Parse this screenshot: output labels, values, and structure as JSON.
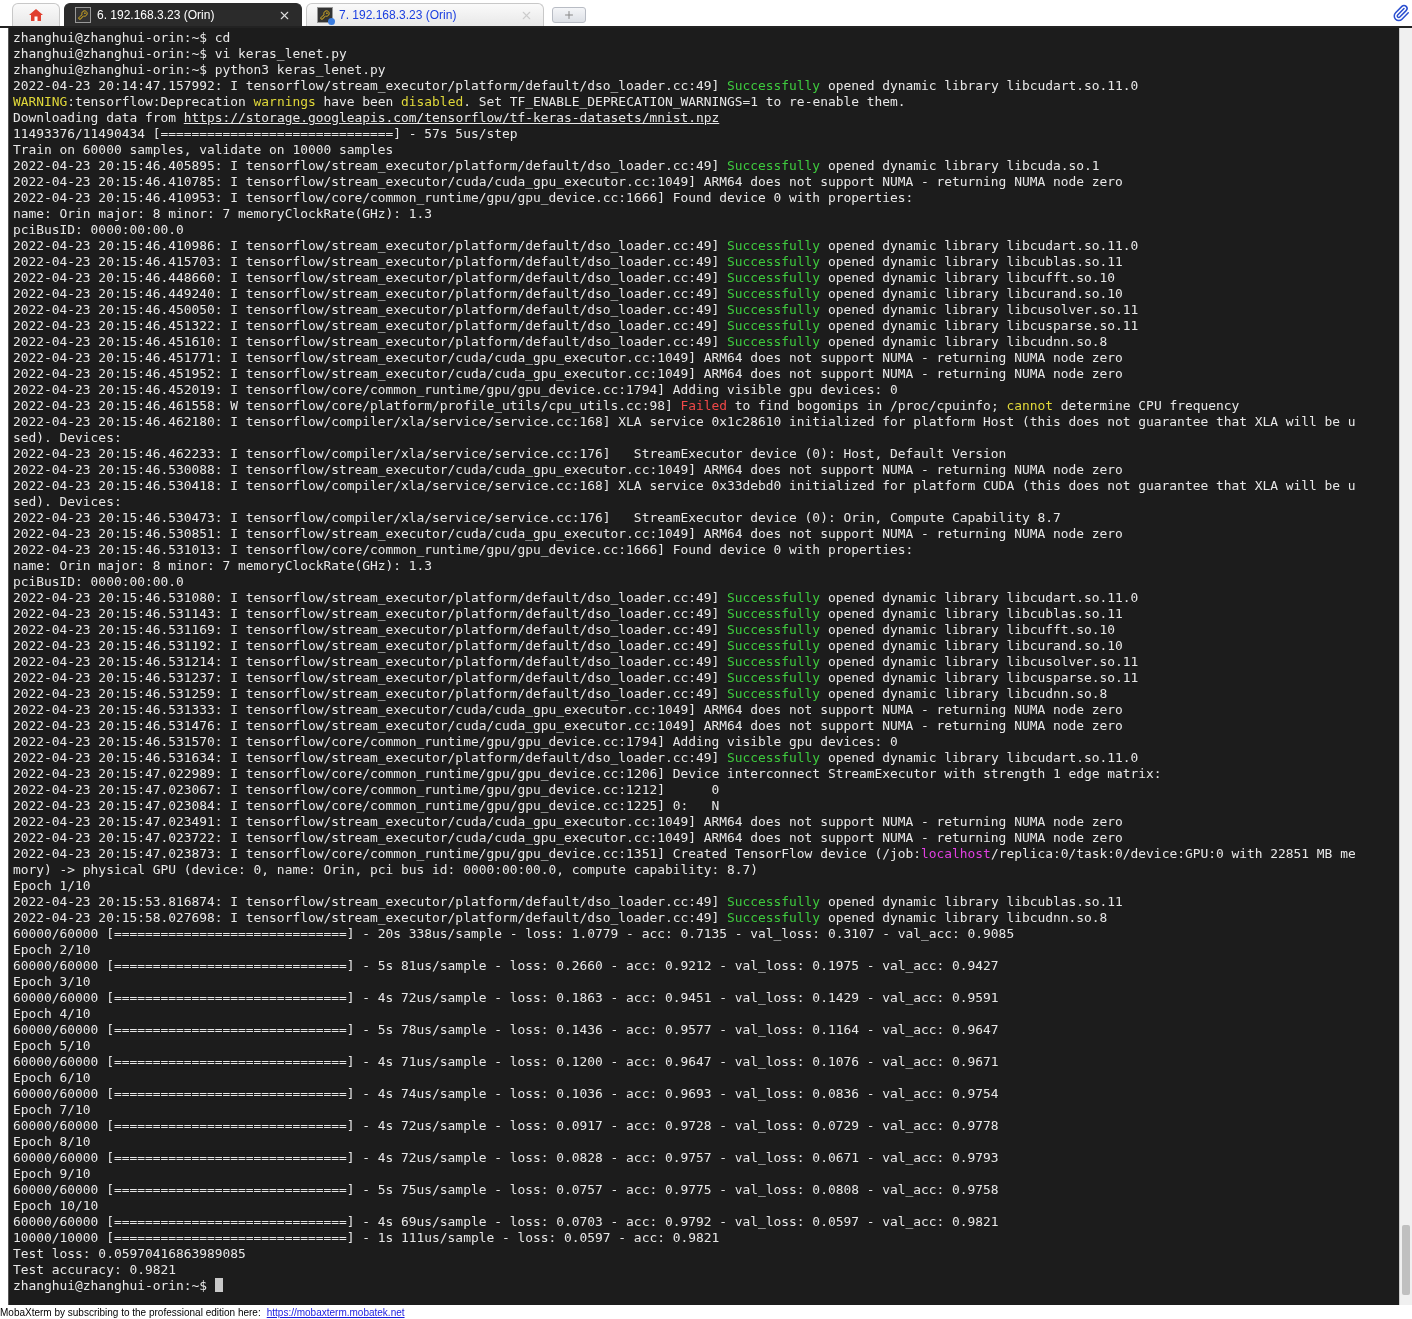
{
  "tabs": [
    {
      "kind": "home",
      "selected": false
    },
    {
      "kind": "session",
      "label": "6. 192.168.3.23 (Orin)",
      "selected": true
    },
    {
      "kind": "session",
      "label": "7. 192.168.3.23 (Orin)",
      "selected": false
    }
  ],
  "terminal": {
    "lines": [
      {
        "text": "zhanghui@zhanghui-orin:~$ cd"
      },
      {
        "text": "zhanghui@zhanghui-orin:~$ vi keras_lenet.py"
      },
      {
        "text": "zhanghui@zhanghui-orin:~$ python3 keras_lenet.py"
      },
      {
        "parts": [
          {
            "kind": "plain",
            "text": "2022-04-23 20:14:47.157992: I tensorflow/stream_executor/platform/default/dso_loader.cc:49] "
          },
          {
            "kind": "success",
            "text": "Successfully"
          },
          {
            "kind": "plain",
            "text": " opened dynamic library libcudart.so.11.0"
          }
        ]
      },
      {
        "parts": [
          {
            "kind": "warn",
            "text": "WARNING"
          },
          {
            "kind": "plain",
            "text": ":tensorflow:Deprecation "
          },
          {
            "kind": "warn",
            "text": "warnings"
          },
          {
            "kind": "plain",
            "text": " have been "
          },
          {
            "kind": "warn",
            "text": "disabled"
          },
          {
            "kind": "plain",
            "text": ". Set TF_ENABLE_DEPRECATION_WARNINGS=1 to re-enable them."
          }
        ]
      },
      {
        "parts": [
          {
            "kind": "plain",
            "text": "Downloading data from "
          },
          {
            "kind": "link",
            "text": "https://storage.googleapis.com/tensorflow/tf-keras-datasets/mnist.npz"
          }
        ]
      },
      {
        "text": "11493376/11490434 [==============================] - 57s 5us/step"
      },
      {
        "text": "Train on 60000 samples, validate on 10000 samples"
      },
      {
        "parts": [
          {
            "kind": "plain",
            "text": "2022-04-23 20:15:46.405895: I tensorflow/stream_executor/platform/default/dso_loader.cc:49] "
          },
          {
            "kind": "success",
            "text": "Successfully"
          },
          {
            "kind": "plain",
            "text": " opened dynamic library libcuda.so.1"
          }
        ]
      },
      {
        "text": "2022-04-23 20:15:46.410785: I tensorflow/stream_executor/cuda/cuda_gpu_executor.cc:1049] ARM64 does not support NUMA - returning NUMA node zero"
      },
      {
        "text": "2022-04-23 20:15:46.410953: I tensorflow/core/common_runtime/gpu/gpu_device.cc:1666] Found device 0 with properties:"
      },
      {
        "text": "name: Orin major: 8 minor: 7 memoryClockRate(GHz): 1.3"
      },
      {
        "text": "pciBusID: 0000:00:00.0"
      },
      {
        "parts": [
          {
            "kind": "plain",
            "text": "2022-04-23 20:15:46.410986: I tensorflow/stream_executor/platform/default/dso_loader.cc:49] "
          },
          {
            "kind": "success",
            "text": "Successfully"
          },
          {
            "kind": "plain",
            "text": " opened dynamic library libcudart.so.11.0"
          }
        ]
      },
      {
        "parts": [
          {
            "kind": "plain",
            "text": "2022-04-23 20:15:46.415703: I tensorflow/stream_executor/platform/default/dso_loader.cc:49] "
          },
          {
            "kind": "success",
            "text": "Successfully"
          },
          {
            "kind": "plain",
            "text": " opened dynamic library libcublas.so.11"
          }
        ]
      },
      {
        "parts": [
          {
            "kind": "plain",
            "text": "2022-04-23 20:15:46.448660: I tensorflow/stream_executor/platform/default/dso_loader.cc:49] "
          },
          {
            "kind": "success",
            "text": "Successfully"
          },
          {
            "kind": "plain",
            "text": " opened dynamic library libcufft.so.10"
          }
        ]
      },
      {
        "parts": [
          {
            "kind": "plain",
            "text": "2022-04-23 20:15:46.449240: I tensorflow/stream_executor/platform/default/dso_loader.cc:49] "
          },
          {
            "kind": "success",
            "text": "Successfully"
          },
          {
            "kind": "plain",
            "text": " opened dynamic library libcurand.so.10"
          }
        ]
      },
      {
        "parts": [
          {
            "kind": "plain",
            "text": "2022-04-23 20:15:46.450050: I tensorflow/stream_executor/platform/default/dso_loader.cc:49] "
          },
          {
            "kind": "success",
            "text": "Successfully"
          },
          {
            "kind": "plain",
            "text": " opened dynamic library libcusolver.so.11"
          }
        ]
      },
      {
        "parts": [
          {
            "kind": "plain",
            "text": "2022-04-23 20:15:46.451322: I tensorflow/stream_executor/platform/default/dso_loader.cc:49] "
          },
          {
            "kind": "success",
            "text": "Successfully"
          },
          {
            "kind": "plain",
            "text": " opened dynamic library libcusparse.so.11"
          }
        ]
      },
      {
        "parts": [
          {
            "kind": "plain",
            "text": "2022-04-23 20:15:46.451610: I tensorflow/stream_executor/platform/default/dso_loader.cc:49] "
          },
          {
            "kind": "success",
            "text": "Successfully"
          },
          {
            "kind": "plain",
            "text": " opened dynamic library libcudnn.so.8"
          }
        ]
      },
      {
        "text": "2022-04-23 20:15:46.451771: I tensorflow/stream_executor/cuda/cuda_gpu_executor.cc:1049] ARM64 does not support NUMA - returning NUMA node zero"
      },
      {
        "text": "2022-04-23 20:15:46.451952: I tensorflow/stream_executor/cuda/cuda_gpu_executor.cc:1049] ARM64 does not support NUMA - returning NUMA node zero"
      },
      {
        "text": "2022-04-23 20:15:46.452019: I tensorflow/core/common_runtime/gpu/gpu_device.cc:1794] Adding visible gpu devices: 0"
      },
      {
        "parts": [
          {
            "kind": "plain",
            "text": "2022-04-23 20:15:46.461558: W tensorflow/core/platform/profile_utils/cpu_utils.cc:98] "
          },
          {
            "kind": "error",
            "text": "Failed"
          },
          {
            "kind": "plain",
            "text": " to find bogomips in /proc/cpuinfo; "
          },
          {
            "kind": "warn",
            "text": "cannot"
          },
          {
            "kind": "plain",
            "text": " determine CPU frequency"
          }
        ]
      },
      {
        "text": "2022-04-23 20:15:46.462180: I tensorflow/compiler/xla/service/service.cc:168] XLA service 0x1c28610 initialized for platform Host (this does not guarantee that XLA will be u"
      },
      {
        "text": "sed). Devices:"
      },
      {
        "text": "2022-04-23 20:15:46.462233: I tensorflow/compiler/xla/service/service.cc:176]   StreamExecutor device (0): Host, Default Version"
      },
      {
        "text": "2022-04-23 20:15:46.530088: I tensorflow/stream_executor/cuda/cuda_gpu_executor.cc:1049] ARM64 does not support NUMA - returning NUMA node zero"
      },
      {
        "text": "2022-04-23 20:15:46.530418: I tensorflow/compiler/xla/service/service.cc:168] XLA service 0x33debd0 initialized for platform CUDA (this does not guarantee that XLA will be u"
      },
      {
        "text": "sed). Devices:"
      },
      {
        "text": "2022-04-23 20:15:46.530473: I tensorflow/compiler/xla/service/service.cc:176]   StreamExecutor device (0): Orin, Compute Capability 8.7"
      },
      {
        "text": "2022-04-23 20:15:46.530851: I tensorflow/stream_executor/cuda/cuda_gpu_executor.cc:1049] ARM64 does not support NUMA - returning NUMA node zero"
      },
      {
        "text": "2022-04-23 20:15:46.531013: I tensorflow/core/common_runtime/gpu/gpu_device.cc:1666] Found device 0 with properties:"
      },
      {
        "text": "name: Orin major: 8 minor: 7 memoryClockRate(GHz): 1.3"
      },
      {
        "text": "pciBusID: 0000:00:00.0"
      },
      {
        "parts": [
          {
            "kind": "plain",
            "text": "2022-04-23 20:15:46.531080: I tensorflow/stream_executor/platform/default/dso_loader.cc:49] "
          },
          {
            "kind": "success",
            "text": "Successfully"
          },
          {
            "kind": "plain",
            "text": " opened dynamic library libcudart.so.11.0"
          }
        ]
      },
      {
        "parts": [
          {
            "kind": "plain",
            "text": "2022-04-23 20:15:46.531143: I tensorflow/stream_executor/platform/default/dso_loader.cc:49] "
          },
          {
            "kind": "success",
            "text": "Successfully"
          },
          {
            "kind": "plain",
            "text": " opened dynamic library libcublas.so.11"
          }
        ]
      },
      {
        "parts": [
          {
            "kind": "plain",
            "text": "2022-04-23 20:15:46.531169: I tensorflow/stream_executor/platform/default/dso_loader.cc:49] "
          },
          {
            "kind": "success",
            "text": "Successfully"
          },
          {
            "kind": "plain",
            "text": " opened dynamic library libcufft.so.10"
          }
        ]
      },
      {
        "parts": [
          {
            "kind": "plain",
            "text": "2022-04-23 20:15:46.531192: I tensorflow/stream_executor/platform/default/dso_loader.cc:49] "
          },
          {
            "kind": "success",
            "text": "Successfully"
          },
          {
            "kind": "plain",
            "text": " opened dynamic library libcurand.so.10"
          }
        ]
      },
      {
        "parts": [
          {
            "kind": "plain",
            "text": "2022-04-23 20:15:46.531214: I tensorflow/stream_executor/platform/default/dso_loader.cc:49] "
          },
          {
            "kind": "success",
            "text": "Successfully"
          },
          {
            "kind": "plain",
            "text": " opened dynamic library libcusolver.so.11"
          }
        ]
      },
      {
        "parts": [
          {
            "kind": "plain",
            "text": "2022-04-23 20:15:46.531237: I tensorflow/stream_executor/platform/default/dso_loader.cc:49] "
          },
          {
            "kind": "success",
            "text": "Successfully"
          },
          {
            "kind": "plain",
            "text": " opened dynamic library libcusparse.so.11"
          }
        ]
      },
      {
        "parts": [
          {
            "kind": "plain",
            "text": "2022-04-23 20:15:46.531259: I tensorflow/stream_executor/platform/default/dso_loader.cc:49] "
          },
          {
            "kind": "success",
            "text": "Successfully"
          },
          {
            "kind": "plain",
            "text": " opened dynamic library libcudnn.so.8"
          }
        ]
      },
      {
        "text": "2022-04-23 20:15:46.531333: I tensorflow/stream_executor/cuda/cuda_gpu_executor.cc:1049] ARM64 does not support NUMA - returning NUMA node zero"
      },
      {
        "text": "2022-04-23 20:15:46.531476: I tensorflow/stream_executor/cuda/cuda_gpu_executor.cc:1049] ARM64 does not support NUMA - returning NUMA node zero"
      },
      {
        "text": "2022-04-23 20:15:46.531570: I tensorflow/core/common_runtime/gpu/gpu_device.cc:1794] Adding visible gpu devices: 0"
      },
      {
        "parts": [
          {
            "kind": "plain",
            "text": "2022-04-23 20:15:46.531634: I tensorflow/stream_executor/platform/default/dso_loader.cc:49] "
          },
          {
            "kind": "success",
            "text": "Successfully"
          },
          {
            "kind": "plain",
            "text": " opened dynamic library libcudart.so.11.0"
          }
        ]
      },
      {
        "text": "2022-04-23 20:15:47.022989: I tensorflow/core/common_runtime/gpu/gpu_device.cc:1206] Device interconnect StreamExecutor with strength 1 edge matrix:"
      },
      {
        "text": "2022-04-23 20:15:47.023067: I tensorflow/core/common_runtime/gpu/gpu_device.cc:1212]      0"
      },
      {
        "text": "2022-04-23 20:15:47.023084: I tensorflow/core/common_runtime/gpu/gpu_device.cc:1225] 0:   N"
      },
      {
        "text": "2022-04-23 20:15:47.023491: I tensorflow/stream_executor/cuda/cuda_gpu_executor.cc:1049] ARM64 does not support NUMA - returning NUMA node zero"
      },
      {
        "text": "2022-04-23 20:15:47.023722: I tensorflow/stream_executor/cuda/cuda_gpu_executor.cc:1049] ARM64 does not support NUMA - returning NUMA node zero"
      },
      {
        "parts": [
          {
            "kind": "plain",
            "text": "2022-04-23 20:15:47.023873: I tensorflow/core/common_runtime/gpu/gpu_device.cc:1351] Created TensorFlow device (/job:"
          },
          {
            "kind": "host",
            "text": "localhost"
          },
          {
            "kind": "plain",
            "text": "/replica:0/task:0/device:GPU:0 with 22851 MB me"
          }
        ]
      },
      {
        "text": "mory) -> physical GPU (device: 0, name: Orin, pci bus id: 0000:00:00.0, compute capability: 8.7)"
      },
      {
        "text": "Epoch 1/10"
      },
      {
        "parts": [
          {
            "kind": "plain",
            "text": "2022-04-23 20:15:53.816874: I tensorflow/stream_executor/platform/default/dso_loader.cc:49] "
          },
          {
            "kind": "success",
            "text": "Successfully"
          },
          {
            "kind": "plain",
            "text": " opened dynamic library libcublas.so.11"
          }
        ]
      },
      {
        "parts": [
          {
            "kind": "plain",
            "text": "2022-04-23 20:15:58.027698: I tensorflow/stream_executor/platform/default/dso_loader.cc:49] "
          },
          {
            "kind": "success",
            "text": "Successfully"
          },
          {
            "kind": "plain",
            "text": " opened dynamic library libcudnn.so.8"
          }
        ]
      },
      {
        "text": "60000/60000 [==============================] - 20s 338us/sample - loss: 1.0779 - acc: 0.7135 - val_loss: 0.3107 - val_acc: 0.9085"
      },
      {
        "text": "Epoch 2/10"
      },
      {
        "text": "60000/60000 [==============================] - 5s 81us/sample - loss: 0.2660 - acc: 0.9212 - val_loss: 0.1975 - val_acc: 0.9427"
      },
      {
        "text": "Epoch 3/10"
      },
      {
        "text": "60000/60000 [==============================] - 4s 72us/sample - loss: 0.1863 - acc: 0.9451 - val_loss: 0.1429 - val_acc: 0.9591"
      },
      {
        "text": "Epoch 4/10"
      },
      {
        "text": "60000/60000 [==============================] - 5s 78us/sample - loss: 0.1436 - acc: 0.9577 - val_loss: 0.1164 - val_acc: 0.9647"
      },
      {
        "text": "Epoch 5/10"
      },
      {
        "text": "60000/60000 [==============================] - 4s 71us/sample - loss: 0.1200 - acc: 0.9647 - val_loss: 0.1076 - val_acc: 0.9671"
      },
      {
        "text": "Epoch 6/10"
      },
      {
        "text": "60000/60000 [==============================] - 4s 74us/sample - loss: 0.1036 - acc: 0.9693 - val_loss: 0.0836 - val_acc: 0.9754"
      },
      {
        "text": "Epoch 7/10"
      },
      {
        "text": "60000/60000 [==============================] - 4s 72us/sample - loss: 0.0917 - acc: 0.9728 - val_loss: 0.0729 - val_acc: 0.9778"
      },
      {
        "text": "Epoch 8/10"
      },
      {
        "text": "60000/60000 [==============================] - 4s 72us/sample - loss: 0.0828 - acc: 0.9757 - val_loss: 0.0671 - val_acc: 0.9793"
      },
      {
        "text": "Epoch 9/10"
      },
      {
        "text": "60000/60000 [==============================] - 5s 75us/sample - loss: 0.0757 - acc: 0.9775 - val_loss: 0.0808 - val_acc: 0.9758"
      },
      {
        "text": "Epoch 10/10"
      },
      {
        "text": "60000/60000 [==============================] - 4s 69us/sample - loss: 0.0703 - acc: 0.9792 - val_loss: 0.0597 - val_acc: 0.9821"
      },
      {
        "text": "10000/10000 [==============================] - 1s 111us/sample - loss: 0.0597 - acc: 0.9821"
      },
      {
        "text": "Test loss: 0.05970416863989085"
      },
      {
        "text": "Test accuracy: 0.9821"
      },
      {
        "text": "zhanghui@zhanghui-orin:~$",
        "cursor": true
      }
    ]
  },
  "status_bar": {
    "text": "MobaXterm by subscribing to the professional edition here:",
    "link": "https://mobaxterm.mobatek.net"
  }
}
